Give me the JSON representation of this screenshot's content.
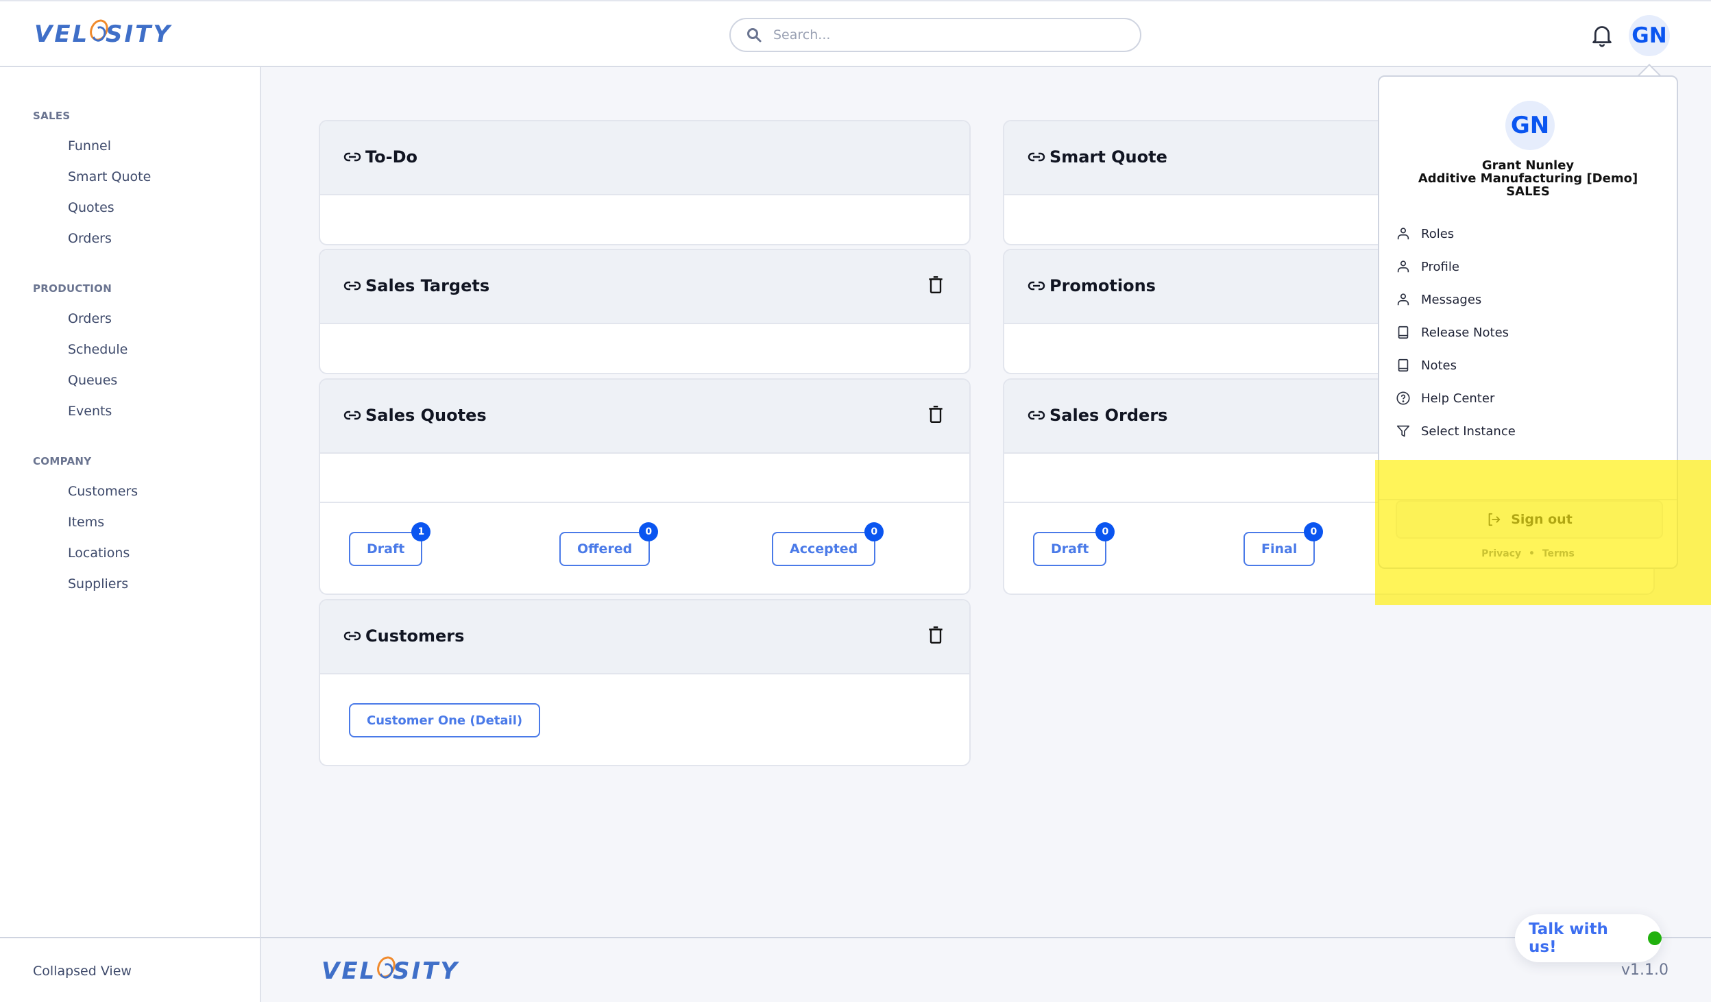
{
  "app": {
    "brand": "VELOCITY",
    "brand_left": "VEL",
    "brand_right": "SITY",
    "version": "v1.1.0"
  },
  "header": {
    "search": {
      "placeholder": "Search...",
      "value": ""
    },
    "notifications_icon": "bell-icon",
    "user_initials": "GN"
  },
  "sidebar": {
    "sections": [
      {
        "title": "SALES",
        "items": [
          "Funnel",
          "Smart Quote",
          "Quotes",
          "Orders"
        ]
      },
      {
        "title": "PRODUCTION",
        "items": [
          "Orders",
          "Schedule",
          "Queues",
          "Events"
        ]
      },
      {
        "title": "COMPANY",
        "items": [
          "Customers",
          "Items",
          "Locations",
          "Suppliers"
        ]
      }
    ],
    "footer_label": "Collapsed View"
  },
  "cards": {
    "todo": {
      "title": "To-Do"
    },
    "smart_quote": {
      "title": "Smart Quote"
    },
    "sales_targets": {
      "title": "Sales Targets"
    },
    "promotions": {
      "title": "Promotions"
    },
    "sales_quotes": {
      "title": "Sales Quotes",
      "statuses": [
        {
          "label": "Draft",
          "count": "1"
        },
        {
          "label": "Offered",
          "count": "0"
        },
        {
          "label": "Accepted",
          "count": "0"
        }
      ]
    },
    "sales_orders": {
      "title": "Sales Orders",
      "statuses": [
        {
          "label": "Draft",
          "count": "0"
        },
        {
          "label": "Final",
          "count": "0"
        }
      ]
    },
    "customers": {
      "title": "Customers",
      "items": [
        "Customer One (Detail)"
      ]
    }
  },
  "user_menu": {
    "initials": "GN",
    "name": "Grant Nunley",
    "organization": "Additive Manufacturing [Demo]",
    "role": "SALES",
    "items": [
      {
        "label": "Roles",
        "icon": "user-icon"
      },
      {
        "label": "Profile",
        "icon": "user-icon"
      },
      {
        "label": "Messages",
        "icon": "user-icon"
      },
      {
        "label": "Release Notes",
        "icon": "book-icon"
      },
      {
        "label": "Notes",
        "icon": "book-icon"
      },
      {
        "label": "Help Center",
        "icon": "help-circle-icon"
      },
      {
        "label": "Select Instance",
        "icon": "filter-icon"
      }
    ],
    "sign_out": "Sign out",
    "privacy": "Privacy",
    "separator": "•",
    "terms": "Terms"
  },
  "chat": {
    "label": "Talk with us!",
    "status_color": "#21b10e"
  },
  "colors": {
    "accent": "#0a55f0",
    "button_blue": "#4a7ae8",
    "highlight": "#fff200"
  }
}
